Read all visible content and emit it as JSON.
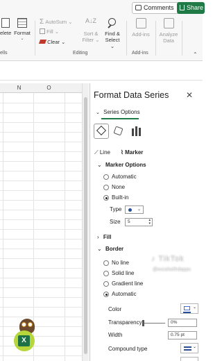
{
  "ribbon": {
    "comments_label": "Comments",
    "share_label": "Share",
    "delete_label": "elete",
    "format_label": "Format",
    "autosum_label": "AutoSum",
    "fill_label": "Fill",
    "clear_label": "Clear",
    "sort_label_1": "Sort &",
    "sort_label_2": "Filter",
    "find_label_1": "Find &",
    "find_label_2": "Select",
    "addins_label": "Add-ins",
    "analyze_label_1": "Analyze",
    "analyze_label_2": "Data",
    "group_cells": "ells",
    "group_editing": "Editing",
    "group_addins": "Add-ins"
  },
  "sheet": {
    "columns": [
      "N",
      "O"
    ]
  },
  "pane": {
    "title": "Format Data Series",
    "series_options_tab": "Series Options",
    "subtabs": {
      "line": "Line",
      "marker": "Marker"
    },
    "marker_options": {
      "header": "Marker Options",
      "options": [
        "Automatic",
        "None",
        "Built-in"
      ],
      "selected": "Built-in",
      "type_label": "Type",
      "size_label": "Size",
      "size_value": "5"
    },
    "fill_header": "Fill",
    "border": {
      "header": "Border",
      "options": [
        "No line",
        "Solid line",
        "Gradient line",
        "Automatic"
      ],
      "selected": "Automatic",
      "color_label": "Color",
      "transparency_label": "Transparency",
      "transparency_value": "0%",
      "width_label": "Width",
      "width_value": "0.75 pt",
      "compound_label": "Compound type"
    }
  },
  "watermark": {
    "brand": "TikTok",
    "handle": "@excelwithdapps"
  },
  "colors": {
    "accent": "#1f7a45",
    "excel_green": "#1e7145"
  }
}
